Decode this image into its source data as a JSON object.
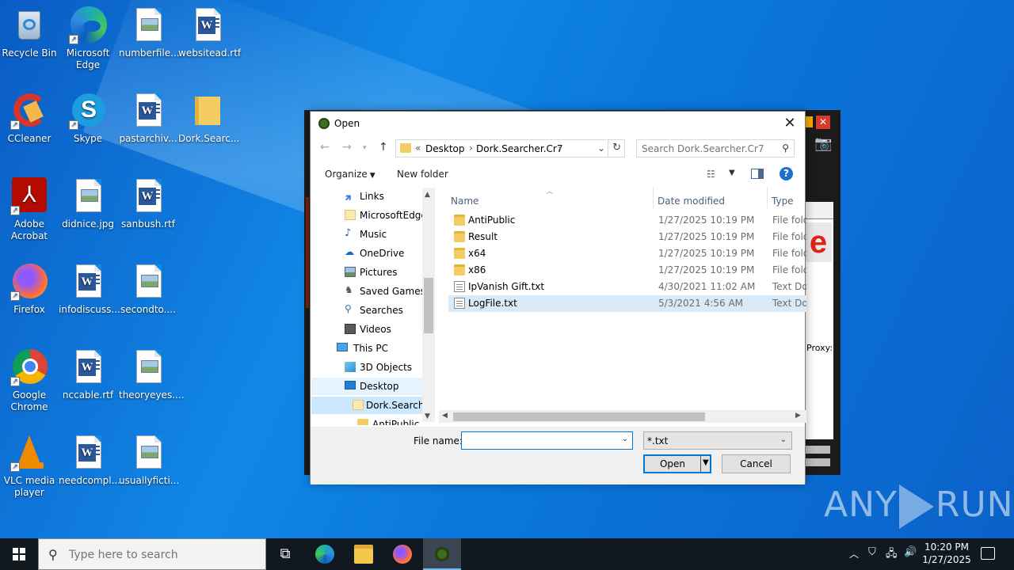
{
  "desktop": {
    "icons": [
      {
        "label": "Recycle Bin"
      },
      {
        "label": "Microsoft Edge"
      },
      {
        "label": "numberfile..."
      },
      {
        "label": "websitead.rtf"
      },
      {
        "label": "CCleaner"
      },
      {
        "label": "Skype"
      },
      {
        "label": "pastarchiv..."
      },
      {
        "label": "Dork.Searc..."
      },
      {
        "label": "Adobe Acrobat"
      },
      {
        "label": "didnice.jpg"
      },
      {
        "label": "sanbush.rtf"
      },
      {
        "label": "Firefox"
      },
      {
        "label": "infodiscuss..."
      },
      {
        "label": "secondto...."
      },
      {
        "label": "Google Chrome"
      },
      {
        "label": "nccable.rtf"
      },
      {
        "label": "theoryeyes...."
      },
      {
        "label": "VLC media player"
      },
      {
        "label": "needcompl..."
      },
      {
        "label": "usuallyficti..."
      }
    ]
  },
  "bg_app": {
    "proxy_label": "Proxy:"
  },
  "dialog": {
    "title": "Open",
    "address": {
      "overflow": "«",
      "crumbs": [
        "Desktop",
        "Dork.Searcher.Cr7"
      ]
    },
    "search_placeholder": "Search Dork.Searcher.Cr7",
    "commands": {
      "organize": "Organize",
      "new_folder": "New folder"
    },
    "nav_items": [
      {
        "label": "Links"
      },
      {
        "label": "MicrosoftEdge"
      },
      {
        "label": "Music"
      },
      {
        "label": "OneDrive"
      },
      {
        "label": "Pictures"
      },
      {
        "label": "Saved Games"
      },
      {
        "label": "Searches"
      },
      {
        "label": "Videos"
      },
      {
        "label": "This PC"
      },
      {
        "label": "3D Objects"
      },
      {
        "label": "Desktop"
      },
      {
        "label": "Dork.Searcher"
      },
      {
        "label": "AntiPublic"
      }
    ],
    "columns": {
      "name": "Name",
      "date": "Date modified",
      "type": "Type"
    },
    "files": [
      {
        "name": "AntiPublic",
        "date": "1/27/2025 10:19 PM",
        "type": "File folder",
        "kind": "folder"
      },
      {
        "name": "Result",
        "date": "1/27/2025 10:19 PM",
        "type": "File folder",
        "kind": "folder"
      },
      {
        "name": "x64",
        "date": "1/27/2025 10:19 PM",
        "type": "File folder",
        "kind": "folder"
      },
      {
        "name": "x86",
        "date": "1/27/2025 10:19 PM",
        "type": "File folder",
        "kind": "folder"
      },
      {
        "name": "IpVanish Gift.txt",
        "date": "4/30/2021 11:02 AM",
        "type": "Text Document",
        "kind": "text"
      },
      {
        "name": "LogFile.txt",
        "date": "5/3/2021 4:56 AM",
        "type": "Text Document",
        "kind": "text"
      }
    ],
    "file_name_label": "File name:",
    "file_name_value": "",
    "filter_value": "*.txt",
    "open_label": "Open",
    "cancel_label": "Cancel"
  },
  "watermark": {
    "left": "ANY",
    "right": "RUN"
  },
  "taskbar": {
    "search_placeholder": "Type here to search",
    "time": "10:20 PM",
    "date": "1/27/2025"
  }
}
